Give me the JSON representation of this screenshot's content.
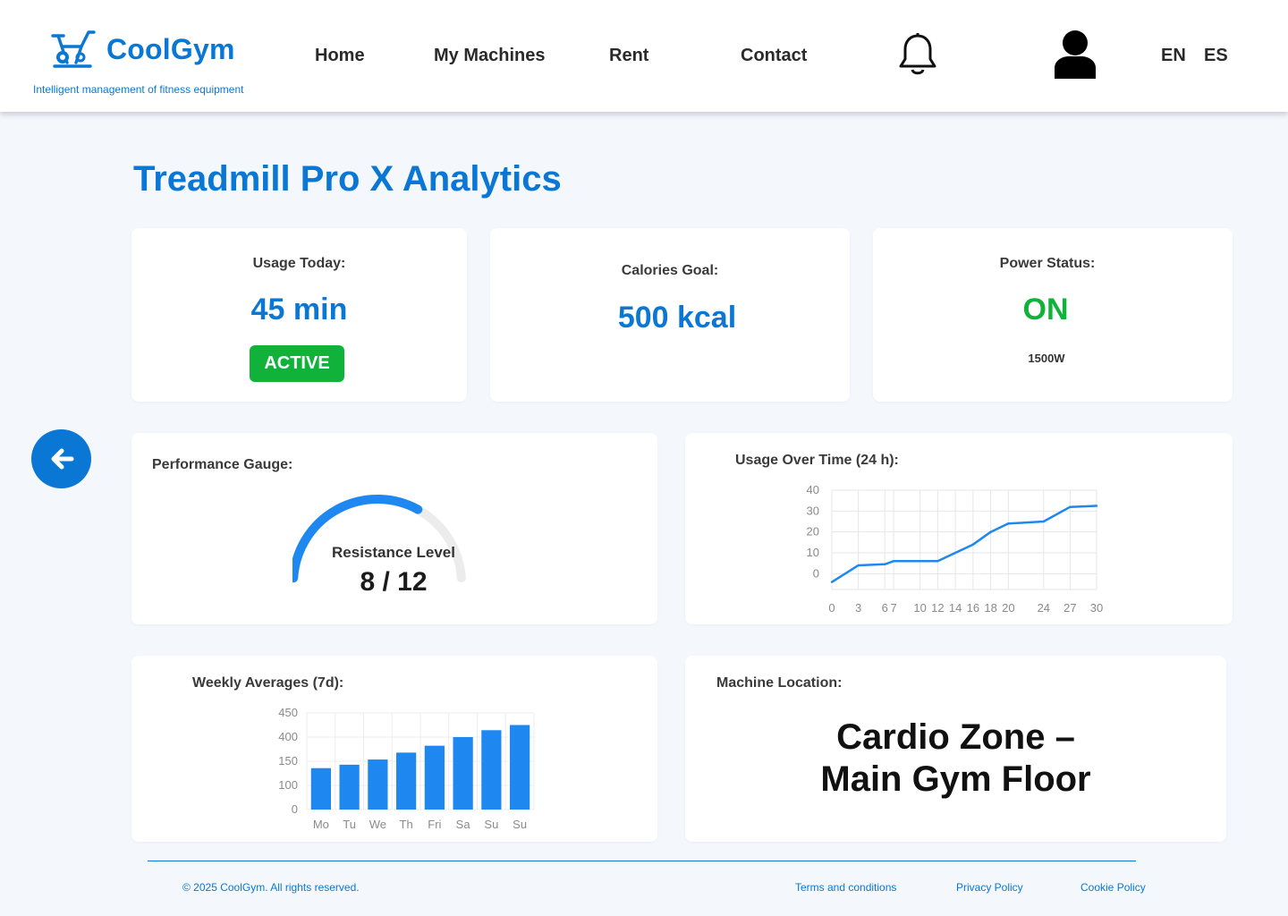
{
  "brand": {
    "name": "CoolGym",
    "tagline": "Intelligent management of fitness equipment",
    "accent": "#0a77d4",
    "icon": "exercise-bike-icon"
  },
  "nav": {
    "items": [
      "Home",
      "My Machines",
      "Rent",
      "Contact"
    ],
    "bell_icon": "bell-icon",
    "user_icon": "user-icon",
    "languages": [
      "EN",
      "ES"
    ]
  },
  "page": {
    "title": "Treadmill Pro X Analytics"
  },
  "stats": {
    "usage": {
      "label": "Usage Today:",
      "value": "45 min",
      "badge": "ACTIVE",
      "badge_color": "#10b23a"
    },
    "calories": {
      "label": "Calories Goal:",
      "value": "500 kcal"
    },
    "power": {
      "label": "Power Status:",
      "value": "ON",
      "watts": "1500W",
      "status_color": "#10b23a"
    }
  },
  "back_button": {
    "icon": "arrow-left-icon"
  },
  "gauge": {
    "label": "Performance Gauge:",
    "caption": "Resistance Level",
    "value_text": "8 / 12",
    "current": 8,
    "max": 12
  },
  "location": {
    "label": "Machine Location:",
    "line1": "Cardio Zone –",
    "line2": "Main Gym Floor"
  },
  "chart_data": [
    {
      "type": "line",
      "title": "Usage Over Time (24 h):",
      "x_ticks": [
        "0",
        "3",
        "6",
        "7",
        "10",
        "12",
        "14",
        "16",
        "18",
        "20",
        "24",
        "27",
        "30"
      ],
      "y_ticks": [
        "0",
        "10",
        "20",
        "30",
        "40"
      ],
      "points": [
        [
          0,
          -4
        ],
        [
          3,
          4
        ],
        [
          6,
          4.5
        ],
        [
          7,
          6
        ],
        [
          10,
          6
        ],
        [
          12,
          6
        ],
        [
          14,
          10
        ],
        [
          16,
          14
        ],
        [
          18,
          20
        ],
        [
          20,
          24
        ],
        [
          24,
          25
        ],
        [
          27,
          32
        ],
        [
          30,
          32.5
        ]
      ],
      "ylim": [
        -5,
        40
      ],
      "grid": true,
      "color": "#1e88f0"
    },
    {
      "type": "bar",
      "title": "Weekly Averages (7d):",
      "categories": [
        "Mo",
        "Tu",
        "We",
        "Th",
        "Fri",
        "Sa",
        "Su",
        "Su"
      ],
      "values": [
        120,
        130,
        145,
        165,
        185,
        210,
        230,
        245
      ],
      "y_ticks": [
        "0",
        "100",
        "150",
        "400",
        "450"
      ],
      "ylim": [
        0,
        280
      ],
      "grid": true,
      "color": "#1e88f0"
    }
  ],
  "footer": {
    "copyright": "© 2025 CoolGym. All rights reserved.",
    "links": [
      "Terms and conditions",
      "Privacy Policy",
      "Cookie Policy"
    ]
  }
}
